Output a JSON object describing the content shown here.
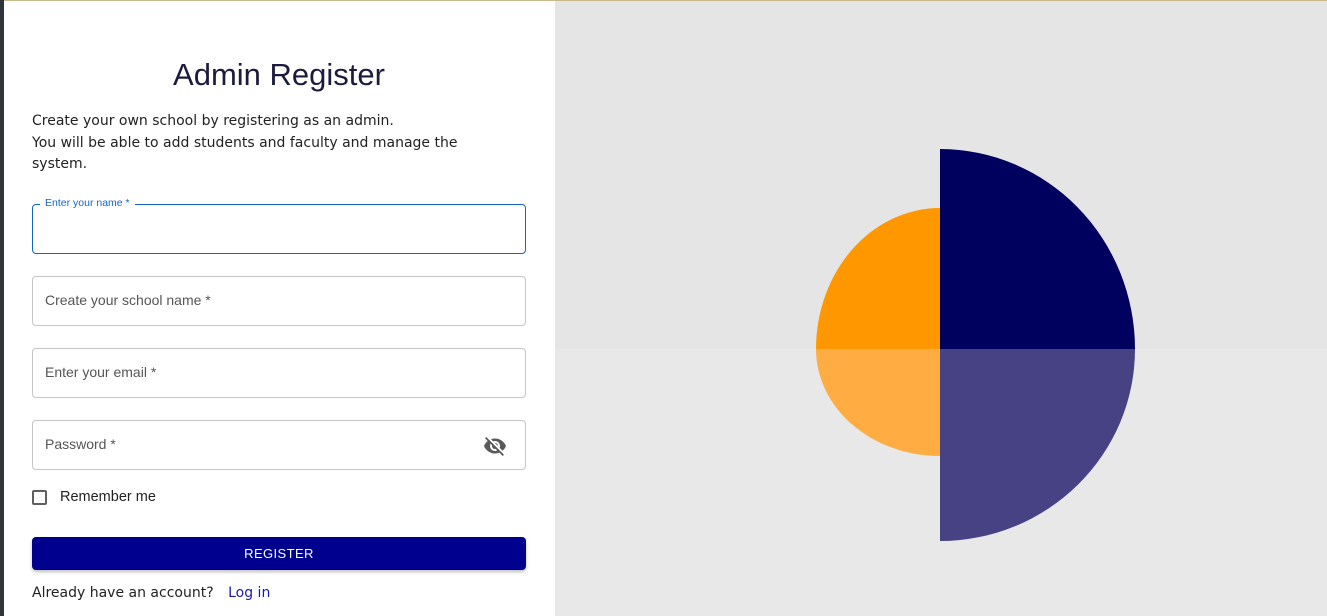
{
  "form": {
    "title": "Admin Register",
    "intro_line1": "Create your own school by registering as an admin.",
    "intro_line2": "You will be able to add students and faculty and manage the",
    "intro_line3": "system.",
    "name_label": "Enter your name *",
    "school_placeholder": "Create your school name *",
    "email_placeholder": "Enter your email *",
    "password_placeholder": "Password *",
    "remember_label": "Remember me",
    "register_label": "REGISTER",
    "account_prompt": "Already have an account?",
    "login_label": "Log in"
  },
  "icons": {
    "password_toggle": "eye-off-icon"
  },
  "colors": {
    "primary_button": "#00008f",
    "focus_blue": "#1565c0",
    "art_orange": "#ff9800",
    "art_orange_light": "#ffad42",
    "art_navy": "#00005f",
    "art_navy_light": "#474284",
    "art_background": "#e5e5e5"
  }
}
